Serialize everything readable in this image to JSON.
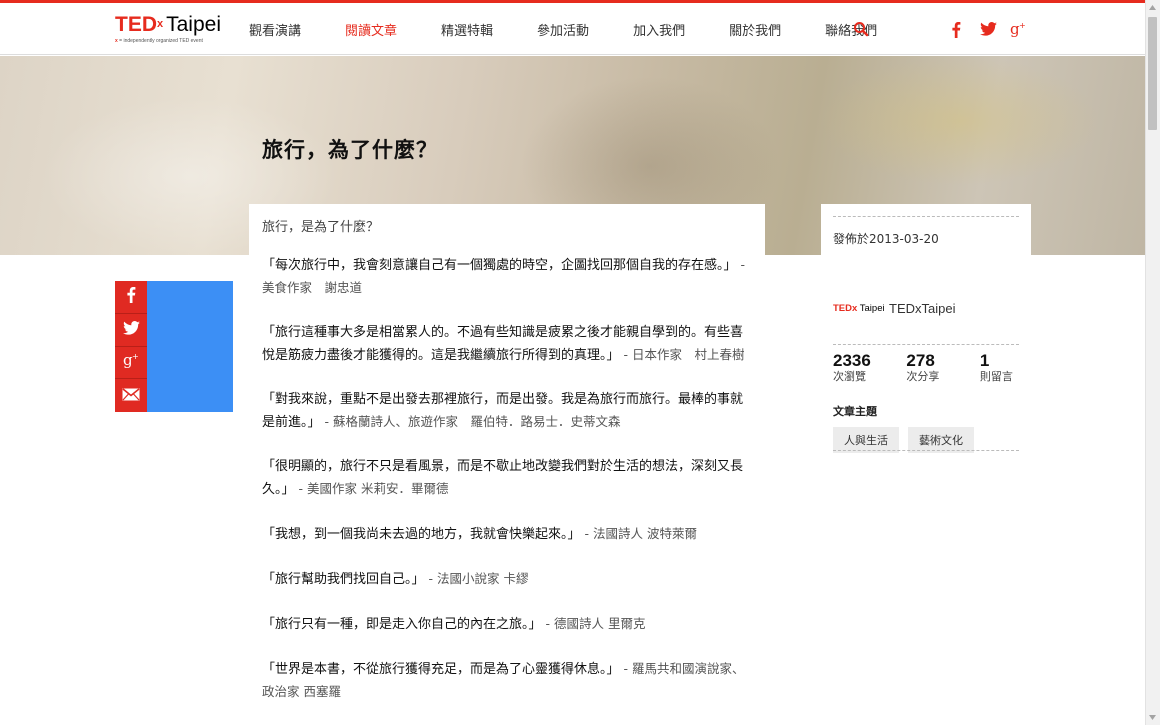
{
  "logo": {
    "ted": "TED",
    "x": "x",
    "city": "Taipei",
    "tagline_x": "x",
    "tagline": " = independently organized TED event"
  },
  "nav": {
    "items": [
      {
        "label": "觀看演講",
        "active": false
      },
      {
        "label": "閱讀文章",
        "active": true
      },
      {
        "label": "精選特輯",
        "active": false
      },
      {
        "label": "參加活動",
        "active": false
      },
      {
        "label": "加入我們",
        "active": false
      },
      {
        "label": "關於我們",
        "active": false
      },
      {
        "label": "聯絡我們",
        "active": false
      }
    ]
  },
  "icons": {
    "search": "search-icon",
    "facebook": "facebook-icon",
    "twitter": "twitter-icon",
    "google_plus": "google-plus-icon",
    "email": "email-icon"
  },
  "colors": {
    "accent": "#e62b1e",
    "share_panel": "#3c8ff5"
  },
  "hero": {
    "title": "旅行，為了什麼？"
  },
  "article": {
    "subtitle": "旅行，是為了什麼？",
    "paragraphs": [
      {
        "quote": "「每次旅行中，我會刻意讓自己有一個獨處的時空，企圖找回那個自我的存在感。」",
        "source": " - 美食作家　謝忠道"
      },
      {
        "quote": "「旅行這種事大多是相當累人的。不過有些知識是疲累之後才能親自學到的。有些喜悅是筋疲力盡後才能獲得的。這是我繼續旅行所得到的真理。」",
        "source": " - 日本作家　村上春樹"
      },
      {
        "quote": "「對我來說，重點不是出發去那裡旅行，而是出發。我是為旅行而旅行。最棒的事就是前進。」",
        "source": " - 蘇格蘭詩人、旅遊作家　羅伯特．路易士．史蒂文森"
      },
      {
        "quote": "「很明顯的，旅行不只是看風景，而是不歇止地改變我們對於生活的想法，深刻又長久。」",
        "source": " - 美國作家 米莉安．畢爾德"
      },
      {
        "quote": "「我想，到一個我尚未去過的地方，我就會快樂起來。」",
        "source": " - 法國詩人 波特萊爾"
      },
      {
        "quote": "「旅行幫助我們找回自己。」",
        "source": " - 法國小說家 卡繆"
      },
      {
        "quote": "「旅行只有一種，即是走入你自己的內在之旅。」",
        "source": " - 德國詩人 里爾克"
      },
      {
        "quote": "「世界是本書，不從旅行獲得充足，而是為了心靈獲得休息。」",
        "source": " - 羅馬共和國演說家、政治家 西塞羅"
      }
    ]
  },
  "sidebar": {
    "published": "發佈於2013-03-20",
    "author": {
      "logo_ted": "TEDx",
      "logo_city": " Taipei",
      "name": "TEDxTaipei"
    },
    "stats": [
      {
        "value": "2336",
        "label": "次瀏覽"
      },
      {
        "value": "278",
        "label": "次分享"
      },
      {
        "value": "1",
        "label": "則留言"
      }
    ],
    "topics_title": "文章主題",
    "tags": [
      "人與生活",
      "藝術文化"
    ]
  }
}
